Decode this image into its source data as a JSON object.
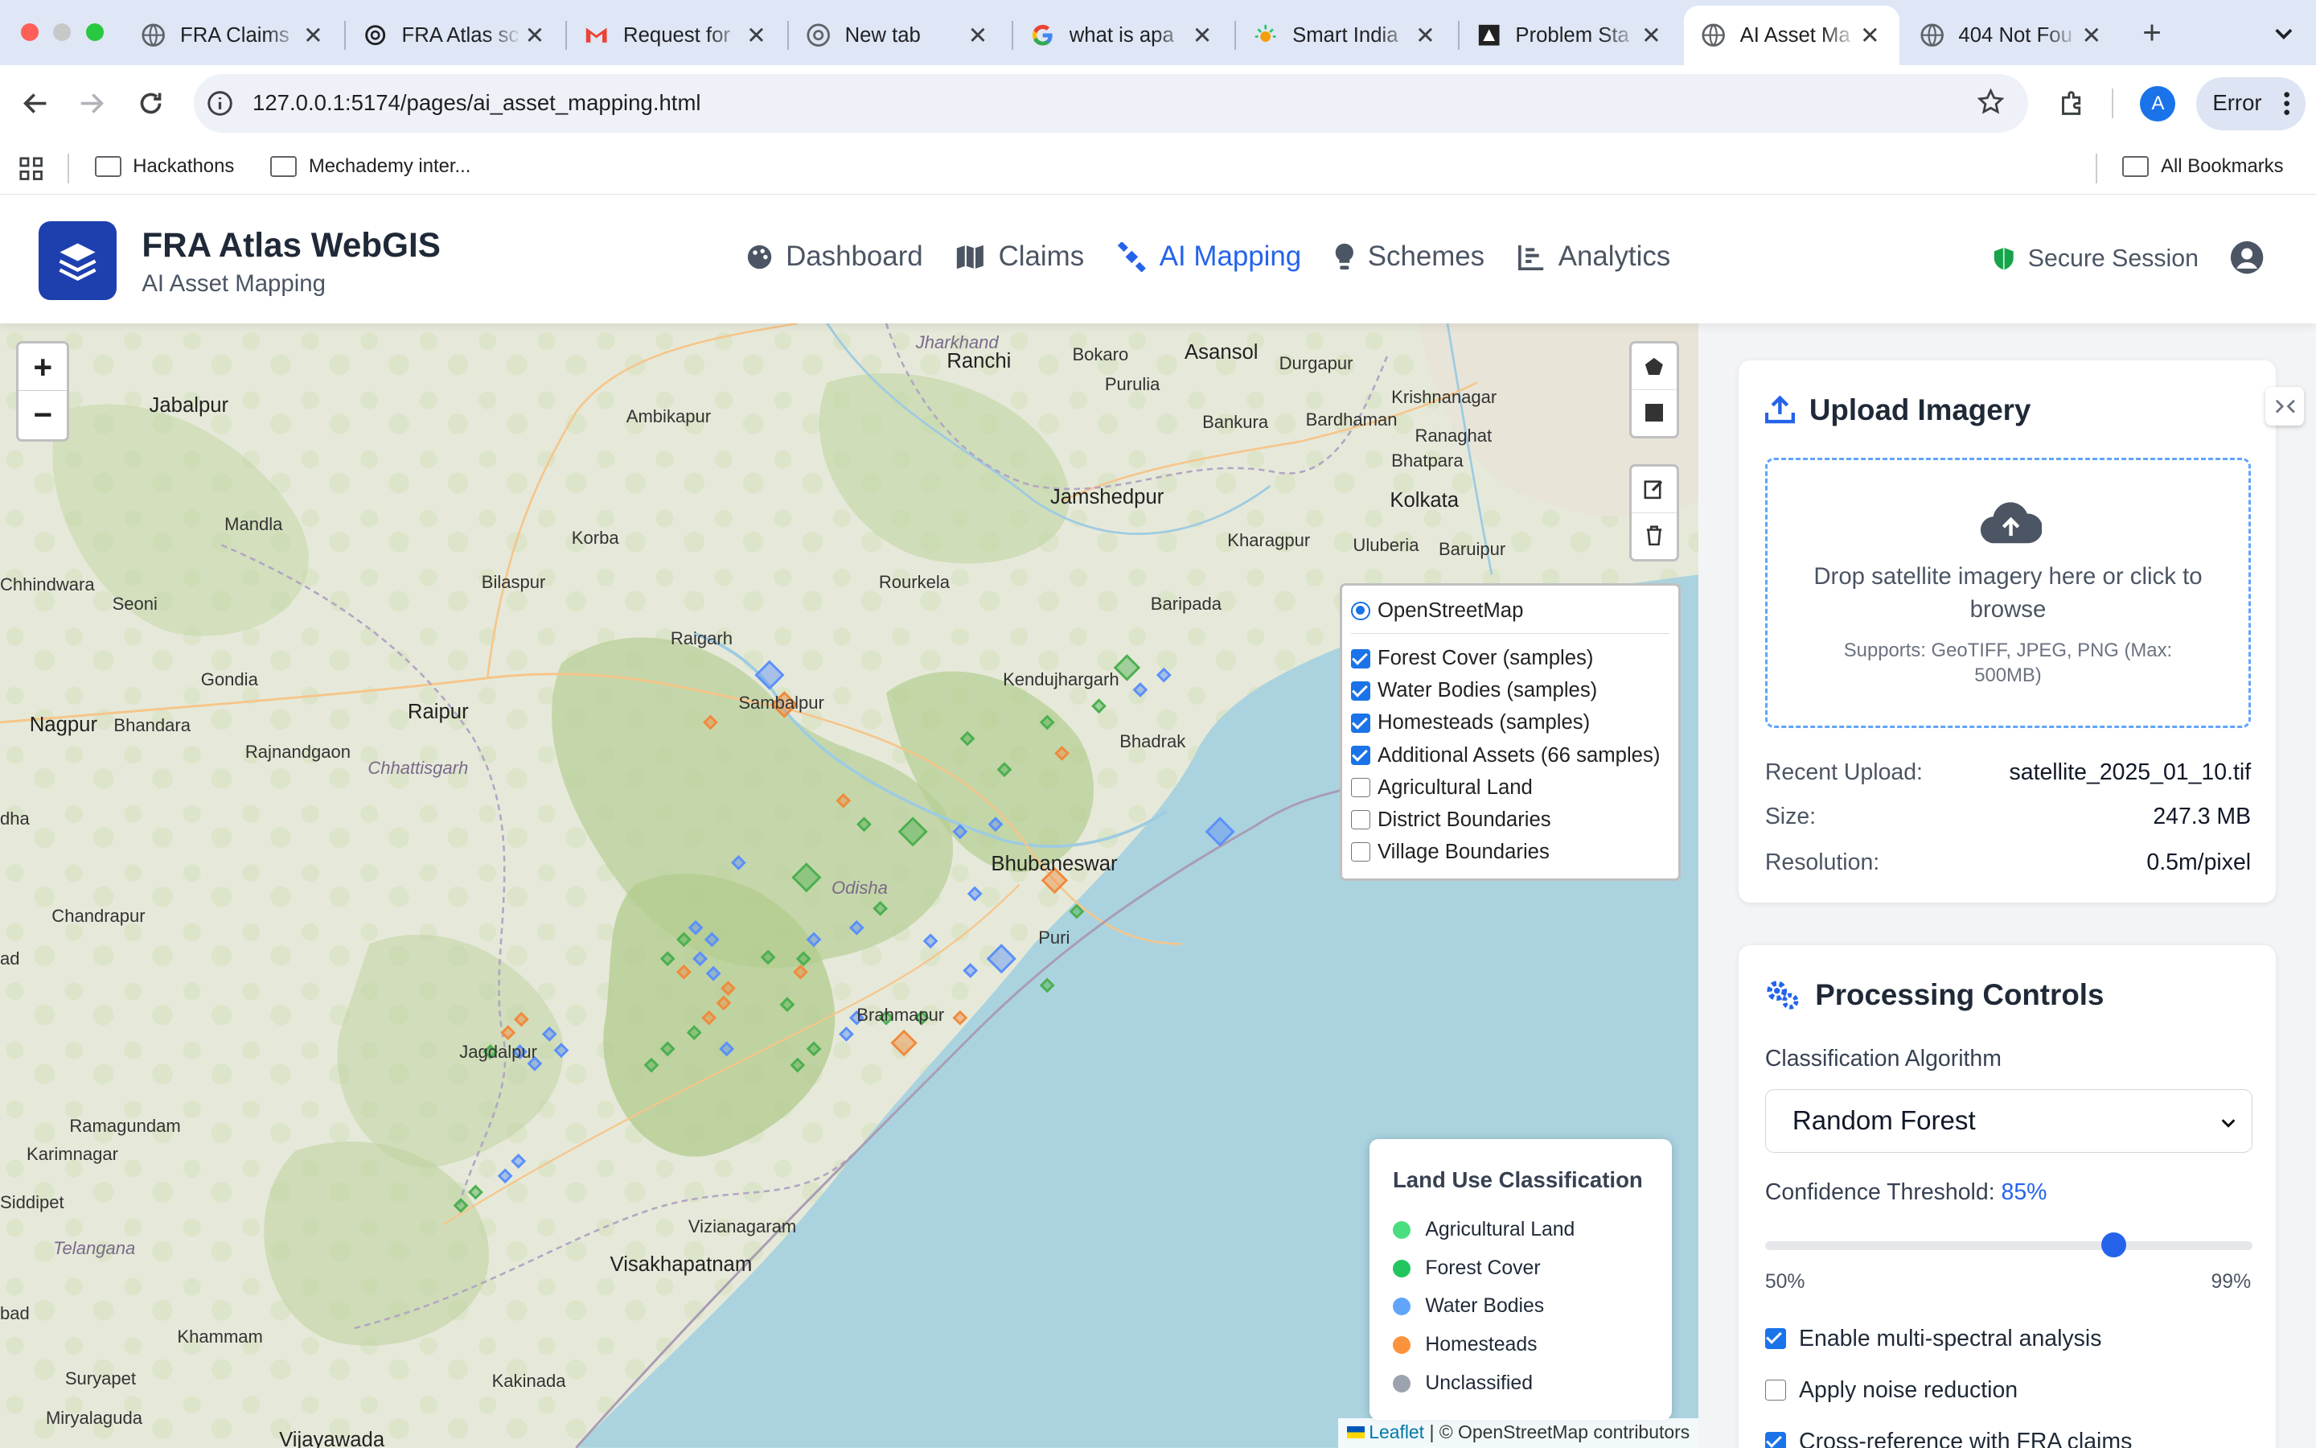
{
  "browser": {
    "tabs": [
      {
        "title": "FRA Claims",
        "icon": "globe-icon"
      },
      {
        "title": "FRA Atlas sc",
        "icon": "openai-icon"
      },
      {
        "title": "Request for",
        "icon": "gmail-icon"
      },
      {
        "title": "New tab",
        "icon": "chrome-icon"
      },
      {
        "title": "what is apa",
        "icon": "google-icon"
      },
      {
        "title": "Smart India",
        "icon": "sun-icon"
      },
      {
        "title": "Problem Sta",
        "icon": "puzzle-icon"
      },
      {
        "title": "AI Asset Ma",
        "icon": "globe-icon"
      },
      {
        "title": "404 Not Fou",
        "icon": "globe-icon"
      }
    ],
    "url": "127.0.0.1:5174/pages/ai_asset_mapping.html",
    "profile_initial": "A",
    "error_label": "Error",
    "bookmarks": [
      "Hackathons",
      "Mechademy inter..."
    ],
    "all_bookmarks": "All Bookmarks"
  },
  "app": {
    "title": "FRA Atlas WebGIS",
    "subtitle": "AI Asset Mapping",
    "nav": [
      {
        "label": "Dashboard",
        "icon": "palette-icon"
      },
      {
        "label": "Claims",
        "icon": "map-icon"
      },
      {
        "label": "AI Mapping",
        "icon": "satellite-icon"
      },
      {
        "label": "Schemes",
        "icon": "lightbulb-icon"
      },
      {
        "label": "Analytics",
        "icon": "chart-icon"
      }
    ],
    "active_nav": "AI Mapping",
    "secure_label": "Secure Session",
    "accent": "#2563eb"
  },
  "map": {
    "places": {
      "jharkhand": "Jharkhand",
      "bokaro": "Bokaro",
      "asansol": "Asansol",
      "durgapur": "Durgapur",
      "ranchi": "Ranchi",
      "purulia": "Purulia",
      "jabalpur": "Jabalpur",
      "ambikapur": "Ambikapur",
      "bankura": "Bankura",
      "bardhaman": "Bardhaman",
      "krishnanagar": "Krishnanagar",
      "ranaghat": "Ranaghat",
      "bhatpara": "Bhatpara",
      "mandla": "Mandla",
      "jamshedpur": "Jamshedpur",
      "korba": "Korba",
      "kolkata": "Kolkata",
      "kharagpur": "Kharagpur",
      "uluberia": "Uluberia",
      "baruipur": "Baruipur",
      "bilaspur": "Bilaspur",
      "chhindwara": "Chhindwara",
      "seoni": "Seoni",
      "rourkela": "Rourkela",
      "baripada": "Baripada",
      "raigarh": "Raigarh",
      "kendujhargarh": "Kendujhargarh",
      "gondia": "Gondia",
      "sambalpur": "Sambalpur",
      "nagpur": "Nagpur",
      "bhandara": "Bhandara",
      "raipur": "Raipur",
      "bhadrak": "Bhadrak",
      "rajnandgaon": "Rajnandgaon",
      "chhattisgarh": "Chhattisgarh",
      "bhubaneswar": "Bhubaneswar",
      "odisha": "Odisha",
      "chandrapur": "Chandrapur",
      "puri": "Puri",
      "brahmapur": "Brahmapur",
      "jagdalpur": "Jagdalpur",
      "ramagundam": "Ramagundam",
      "karimnagar": "Karimnagar",
      "siddipet": "Siddipet",
      "vizianagaram": "Vizianagaram",
      "telangana": "Telangana",
      "visakhapatnam": "Visakhapatnam",
      "khammam": "Khammam",
      "suryapet": "Suryapet",
      "kakinada": "Kakinada",
      "miryalaguda": "Miryalaguda",
      "vijayawada": "Vijayawada",
      "hyderabad_cut": "dha",
      "adilabad_cut": "ad",
      "nalgonda_cut": "bad"
    },
    "layers": {
      "base": "OpenStreetMap",
      "overlays": [
        {
          "label": "Forest Cover (samples)",
          "checked": true
        },
        {
          "label": "Water Bodies (samples)",
          "checked": true
        },
        {
          "label": "Homesteads (samples)",
          "checked": true
        },
        {
          "label": "Additional Assets (66 samples)",
          "checked": true
        },
        {
          "label": "Agricultural Land",
          "checked": false
        },
        {
          "label": "District Boundaries",
          "checked": false
        },
        {
          "label": "Village Boundaries",
          "checked": false
        }
      ]
    },
    "legend": {
      "title": "Land Use Classification",
      "items": [
        {
          "label": "Agricultural Land",
          "color": "#4ade80"
        },
        {
          "label": "Forest Cover",
          "color": "#22c55e"
        },
        {
          "label": "Water Bodies",
          "color": "#60a5fa"
        },
        {
          "label": "Homesteads",
          "color": "#fb923c"
        },
        {
          "label": "Unclassified",
          "color": "#9ca3af"
        }
      ]
    },
    "attribution": {
      "leaflet": "Leaflet",
      "rest": "| © OpenStreetMap contributors"
    }
  },
  "upload": {
    "title": "Upload Imagery",
    "drop_text": "Drop satellite imagery here or click to browse",
    "supports": "Supports: GeoTIFF, JPEG, PNG (Max: 500MB)",
    "recent_label": "Recent Upload:",
    "recent_value": "satellite_2025_01_10.tif",
    "size_label": "Size:",
    "size_value": "247.3 MB",
    "res_label": "Resolution:",
    "res_value": "0.5m/pixel"
  },
  "processing": {
    "title": "Processing Controls",
    "algo_label": "Classification Algorithm",
    "algo_value": "Random Forest",
    "conf_label": "Confidence Threshold:",
    "conf_value": "85%",
    "conf_min": "50%",
    "conf_max": "99%",
    "conf_level": 85,
    "options": [
      {
        "label": "Enable multi-spectral analysis",
        "checked": true
      },
      {
        "label": "Apply noise reduction",
        "checked": false
      },
      {
        "label": "Cross-reference with FRA claims",
        "checked": true
      }
    ]
  }
}
